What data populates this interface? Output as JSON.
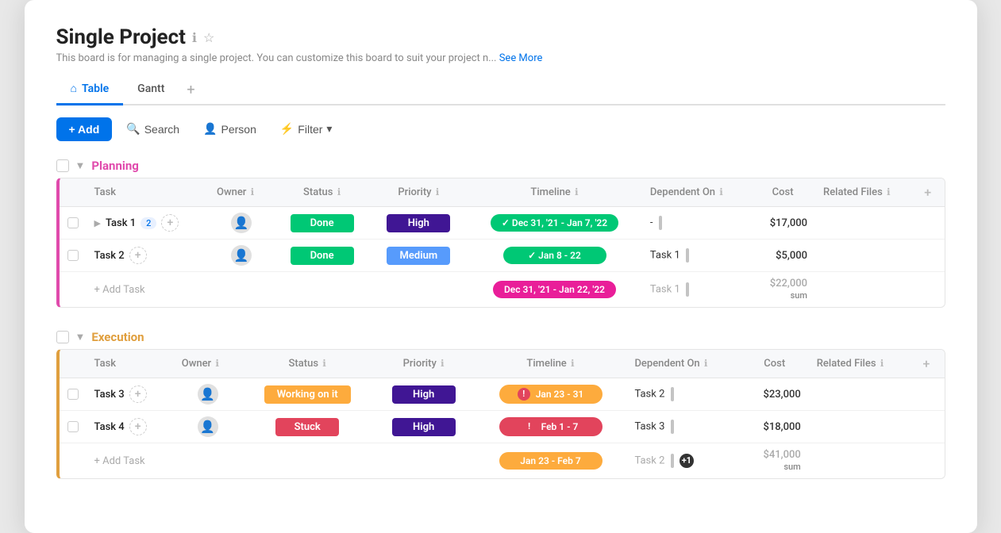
{
  "window": {
    "title": "Single Project",
    "description": "This board is for managing a single project. You can customize this board to suit your project n...",
    "see_more": "See More"
  },
  "tabs": [
    {
      "label": "Table",
      "active": true,
      "icon": "home"
    },
    {
      "label": "Gantt",
      "active": false
    }
  ],
  "toolbar": {
    "add_label": "+ Add",
    "search_label": "Search",
    "person_label": "Person",
    "filter_label": "Filter"
  },
  "sections": [
    {
      "id": "planning",
      "title": "Planning",
      "color": "planning",
      "columns": [
        "Task",
        "Owner",
        "Status",
        "Priority",
        "Timeline",
        "Dependent On",
        "Cost",
        "Related Files"
      ],
      "rows": [
        {
          "task": "Task 1",
          "subtask_count": "2",
          "has_expand": true,
          "status": "Done",
          "status_class": "status-done",
          "priority": "High",
          "priority_class": "priority-high",
          "timeline": "Dec 31, '21 - Jan 7, '22",
          "timeline_class": "timeline-green",
          "timeline_icon": "check",
          "dependent_on": "-",
          "cost": "$17,000"
        },
        {
          "task": "Task 2",
          "has_expand": false,
          "status": "Done",
          "status_class": "status-done",
          "priority": "Medium",
          "priority_class": "priority-medium",
          "timeline": "Jan 8 - 22",
          "timeline_class": "timeline-green",
          "timeline_icon": "check",
          "dependent_on": "Task 1",
          "cost": "$5,000"
        }
      ],
      "sum_timeline": "Dec 31, '21 - Jan 22, '22",
      "sum_timeline_class": "timeline-pink",
      "sum_dependent": "Task 1",
      "sum_cost": "$22,000",
      "sum_label": "sum"
    },
    {
      "id": "execution",
      "title": "Execution",
      "color": "execution",
      "columns": [
        "Task",
        "Owner",
        "Status",
        "Priority",
        "Timeline",
        "Dependent On",
        "Cost",
        "Related Files"
      ],
      "rows": [
        {
          "task": "Task 3",
          "has_expand": false,
          "status": "Working on it",
          "status_class": "status-working",
          "priority": "High",
          "priority_class": "priority-high",
          "timeline": "Jan 23 - 31",
          "timeline_class": "timeline-orange",
          "timeline_icon": "excl",
          "dependent_on": "Task 2",
          "cost": "$23,000"
        },
        {
          "task": "Task 4",
          "has_expand": false,
          "status": "Stuck",
          "status_class": "status-stuck",
          "priority": "High",
          "priority_class": "priority-high",
          "timeline": "Feb 1 - 7",
          "timeline_class": "timeline-red",
          "timeline_icon": "excl",
          "dependent_on": "Task 3",
          "cost": "$18,000"
        }
      ],
      "sum_timeline": "Jan 23 - Feb 7",
      "sum_timeline_class": "timeline-orange",
      "sum_dependent": "Task 2",
      "sum_dependent_badge": "+1",
      "sum_cost": "$41,000",
      "sum_label": "sum"
    }
  ]
}
